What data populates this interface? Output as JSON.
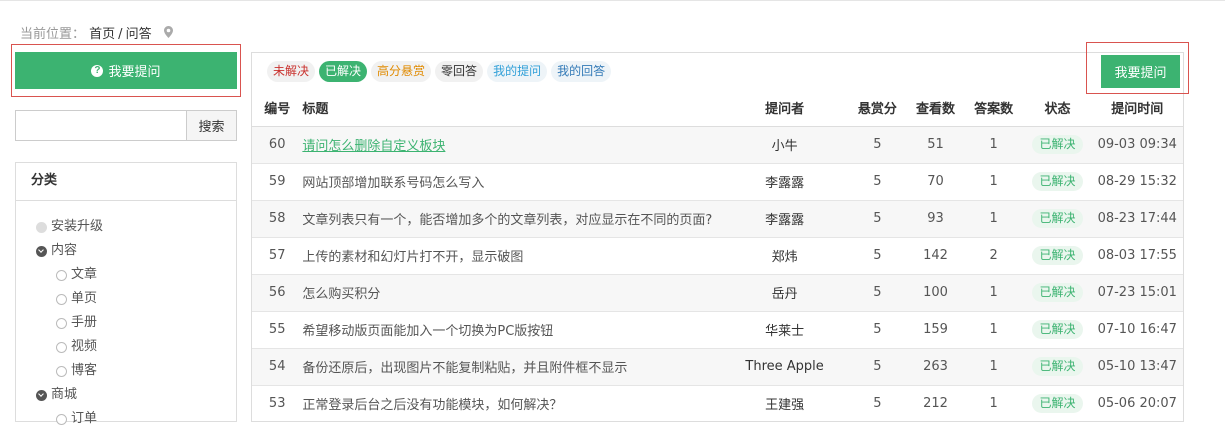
{
  "breadcrumb": {
    "label": "当前位置：",
    "home": "首页",
    "sep": "/",
    "current": "问答"
  },
  "sidebar": {
    "ask_button": "我要提问",
    "search": {
      "placeholder": "",
      "button": "搜索"
    },
    "category_title": "分类",
    "categories": [
      {
        "label": "安装升级",
        "level": 0,
        "state": "leaf"
      },
      {
        "label": "内容",
        "level": 0,
        "state": "open"
      },
      {
        "label": "文章",
        "level": 1,
        "state": "child"
      },
      {
        "label": "单页",
        "level": 1,
        "state": "child"
      },
      {
        "label": "手册",
        "level": 1,
        "state": "child"
      },
      {
        "label": "视频",
        "level": 1,
        "state": "child"
      },
      {
        "label": "博客",
        "level": 1,
        "state": "child"
      },
      {
        "label": "商城",
        "level": 0,
        "state": "open"
      },
      {
        "label": "订单",
        "level": 1,
        "state": "child"
      }
    ]
  },
  "filters": [
    {
      "label": "未解决",
      "style": "red"
    },
    {
      "label": "已解决",
      "style": "green"
    },
    {
      "label": "高分悬赏",
      "style": "orange"
    },
    {
      "label": "零回答",
      "style": "dark"
    },
    {
      "label": "我的提问",
      "style": "cyan"
    },
    {
      "label": "我的回答",
      "style": "blue"
    }
  ],
  "ask_button_right": "我要提问",
  "table": {
    "headers": {
      "id": "编号",
      "title": "标题",
      "asker": "提问者",
      "reward": "悬赏分",
      "views": "查看数",
      "answers": "答案数",
      "status": "状态",
      "time": "提问时间"
    },
    "rows": [
      {
        "id": "60",
        "title": "请问怎么删除自定义板块",
        "link": true,
        "asker": "小牛",
        "reward": "5",
        "views": "51",
        "answers": "1",
        "status": "已解决",
        "time": "09-03 09:34"
      },
      {
        "id": "59",
        "title": "网站顶部增加联系号码怎么写入",
        "asker": "李露露",
        "reward": "5",
        "views": "70",
        "answers": "1",
        "status": "已解决",
        "time": "08-29 15:32"
      },
      {
        "id": "58",
        "title": "文章列表只有一个，能否增加多个的文章列表，对应显示在不同的页面?",
        "asker": "李露露",
        "reward": "5",
        "views": "93",
        "answers": "1",
        "status": "已解决",
        "time": "08-23 17:44"
      },
      {
        "id": "57",
        "title": "上传的素材和幻灯片打不开，显示破图",
        "asker": "郑炜",
        "reward": "5",
        "views": "142",
        "answers": "2",
        "status": "已解决",
        "time": "08-03 17:55"
      },
      {
        "id": "56",
        "title": "怎么购买积分",
        "asker": "岳丹",
        "reward": "5",
        "views": "100",
        "answers": "1",
        "status": "已解决",
        "time": "07-23 15:01"
      },
      {
        "id": "55",
        "title": "希望移动版页面能加入一个切换为PC版按钮",
        "asker": "华莱士",
        "reward": "5",
        "views": "159",
        "answers": "1",
        "status": "已解决",
        "time": "07-10 16:47"
      },
      {
        "id": "54",
        "title": "备份还原后，出现图片不能复制粘贴，并且附件框不显示",
        "asker": "Three Apple",
        "reward": "5",
        "views": "263",
        "answers": "1",
        "status": "已解决",
        "time": "05-10 13:47"
      },
      {
        "id": "53",
        "title": "正常登录后台之后没有功能模块，如何解决？",
        "asker": "王建强",
        "reward": "5",
        "views": "212",
        "answers": "1",
        "status": "已解决",
        "time": "05-06 20:07"
      }
    ]
  }
}
